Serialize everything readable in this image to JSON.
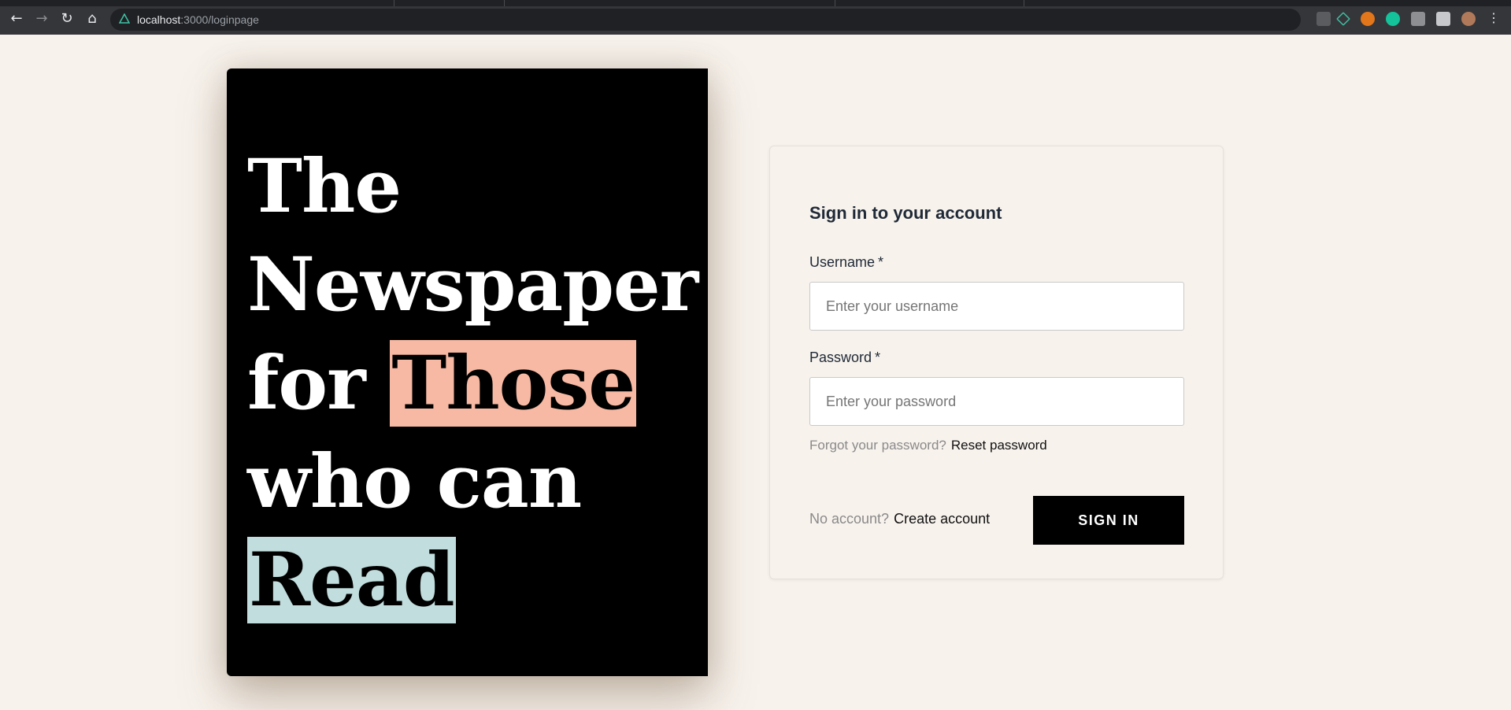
{
  "browser": {
    "url_host": "localhost",
    "url_path": ":3000/loginpage",
    "back_icon": "arrow-left-icon",
    "forward_icon": "arrow-right-icon",
    "reload_icon": "reload-icon",
    "home_icon": "home-icon"
  },
  "poster": {
    "line1": "The",
    "line2": "Newspaper",
    "line3_prefix": "for ",
    "line3_highlight": "Those",
    "line4": "who can",
    "line5_highlight": "Read",
    "highlight_colors": {
      "pink": "#f7b9a3",
      "blue": "#c2dddd"
    }
  },
  "login": {
    "title": "Sign in to your account",
    "username_label": "Username",
    "username_required": "*",
    "username_placeholder": "Enter your username",
    "password_label": "Password",
    "password_required": "*",
    "password_placeholder": "Enter your password",
    "forgot_text": "Forgot your password?",
    "reset_link": "Reset password",
    "no_account_text": "No account?",
    "create_link": "Create account",
    "signin_button": "SIGN IN"
  }
}
